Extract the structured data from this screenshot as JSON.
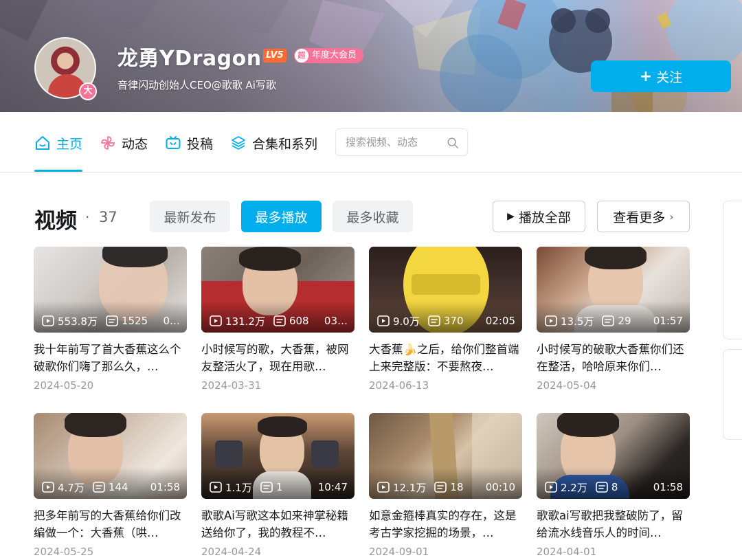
{
  "profile": {
    "name": "龙勇YDragon",
    "level": "LV5",
    "vip_prefix": "超",
    "vip_label": "年度大会员",
    "avatar_badge": "大",
    "sign": "音律闪动创始人CEO@歌歌 Ai写歌",
    "follow_label": "关注"
  },
  "nav": {
    "items": [
      {
        "label": "主页",
        "icon": "home-icon"
      },
      {
        "label": "动态",
        "icon": "pinwheel-icon"
      },
      {
        "label": "投稿",
        "icon": "tv-icon"
      },
      {
        "label": "合集和系列",
        "icon": "layers-icon"
      }
    ],
    "search_placeholder": "搜索视频、动态"
  },
  "section": {
    "title": "视频",
    "dot": "·",
    "count": "37",
    "sort_tabs": [
      "最新发布",
      "最多播放",
      "最多收藏"
    ],
    "active_sort": "最多播放",
    "play_all": "播放全部",
    "more": "查看更多"
  },
  "colors": {
    "accent": "#00aeec",
    "vip": "#fb7299",
    "level": "#ff6a33"
  },
  "videos": [
    {
      "plays": "553.8万",
      "danmaku": "1525",
      "duration": "0…",
      "title": "我十年前写了首大香蕉这么个破歌你们嗨了那么久，…",
      "date": "2024-05-20"
    },
    {
      "plays": "131.2万",
      "danmaku": "608",
      "duration": "03…",
      "title": "小时候写的歌，大香蕉，被网友整活火了，现在用歌…",
      "date": "2024-03-31"
    },
    {
      "plays": "9.0万",
      "danmaku": "370",
      "duration": "02:05",
      "title": "大香蕉🍌之后，给你们整首端上来完整版：不要熬夜…",
      "date": "2024-06-13"
    },
    {
      "plays": "13.5万",
      "danmaku": "29",
      "duration": "01:57",
      "title": "小时候写的破歌大香蕉你们还在整活，哈哈原来你们…",
      "date": "2024-05-04"
    },
    {
      "plays": "4.7万",
      "danmaku": "144",
      "duration": "01:58",
      "title": "把多年前写的大香蕉给你们改编做一个：大香蕉（哄…",
      "date": "2024-05-25"
    },
    {
      "plays": "1.1万",
      "danmaku": "1",
      "duration": "10:47",
      "title": "歌歌Ai写歌这本如来神掌秘籍送给你了，我的教程不…",
      "date": "2024-04-24"
    },
    {
      "plays": "12.1万",
      "danmaku": "18",
      "duration": "00:10",
      "title": "如意金箍棒真实的存在，这是考古学家挖掘的场景，…",
      "date": "2024-09-01"
    },
    {
      "plays": "2.2万",
      "danmaku": "8",
      "duration": "01:58",
      "title": "歌歌ai写歌把我整破防了，留给流水线音乐人的时间…",
      "date": "2024-04-01"
    }
  ]
}
